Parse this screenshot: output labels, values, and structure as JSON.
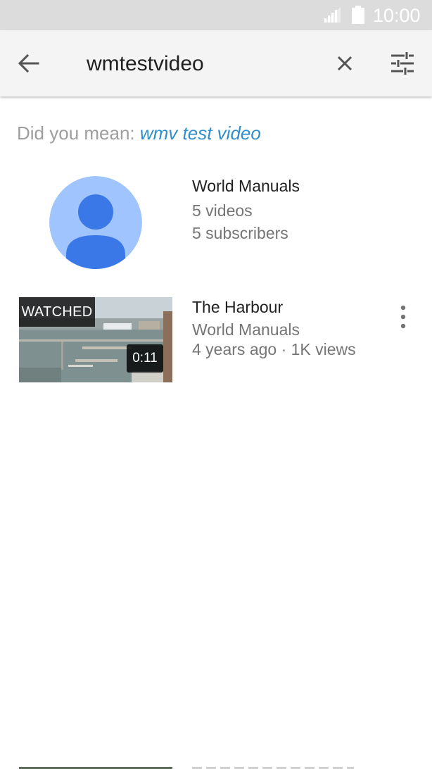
{
  "status_bar": {
    "time": "10:00",
    "icons": [
      "signal-icon",
      "battery-icon"
    ]
  },
  "search": {
    "query": "wmtestvideo",
    "icons": {
      "back": "arrow-left-icon",
      "clear": "close-icon",
      "filter": "tune-icon"
    }
  },
  "suggestion": {
    "prefix": "Did you mean: ",
    "term": "wmv test video"
  },
  "channel": {
    "name": "World Manuals",
    "videos": "5 videos",
    "subscribers": "5 subscribers",
    "avatar_icon": "person-avatar-icon"
  },
  "video": {
    "title": "The Harbour",
    "channel": "World Manuals",
    "meta": "4 years ago · 1K views",
    "watched_label": "WATCHED",
    "duration": "0:11",
    "more_icon": "more-vert-icon"
  },
  "colors": {
    "status_bar": "#dcdcdc",
    "toolbar": "#f4f4f4",
    "link": "#2f8fcb",
    "avatar_bg": "#a0c4fd",
    "avatar_fg": "#3b78e7"
  }
}
